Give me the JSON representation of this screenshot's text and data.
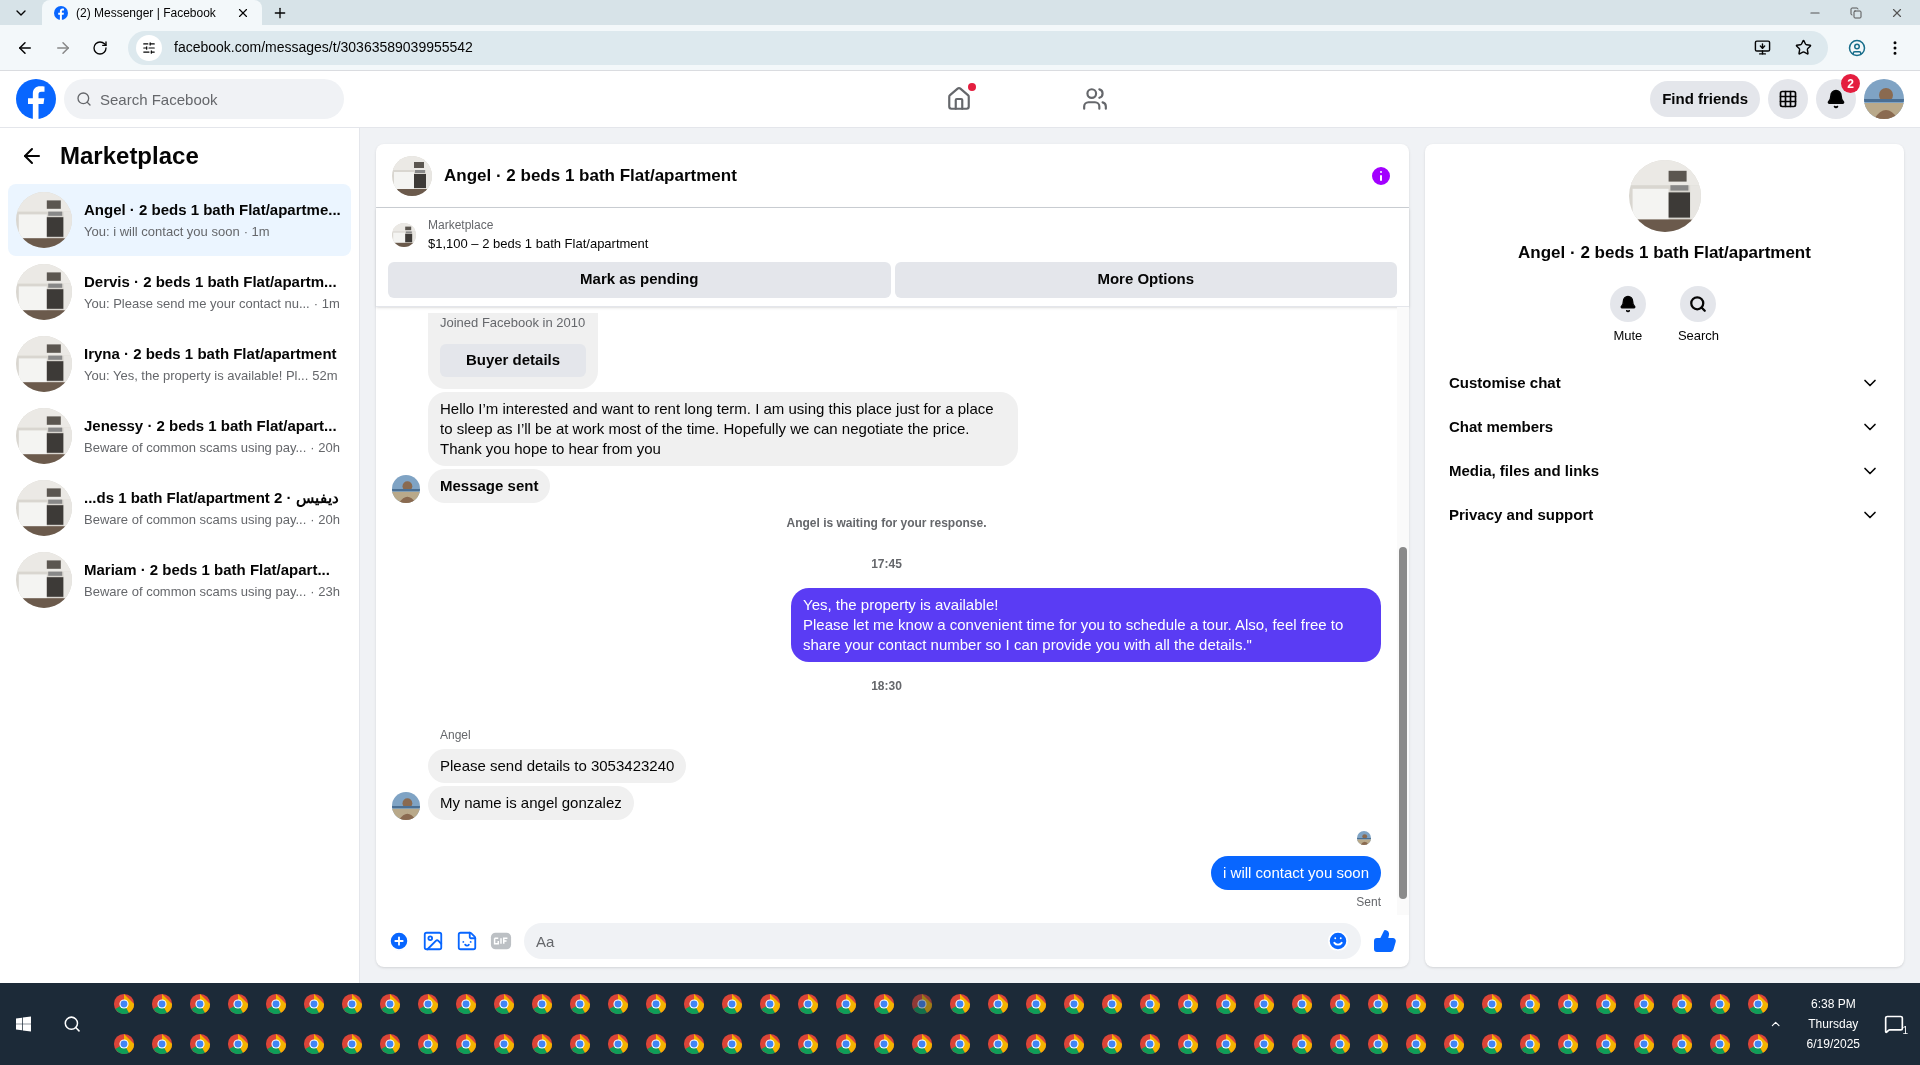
{
  "browser": {
    "tab_title": "(2) Messenger | Facebook",
    "url": "facebook.com/messages/t/30363589039955542"
  },
  "topbar": {
    "search": {
      "placeholder": "Search Facebook"
    },
    "find_friends": "Find friends",
    "notification_count": "2"
  },
  "sidebar": {
    "title": "Marketplace",
    "conversations": [
      {
        "title": "Angel · 2 beds 1 bath Flat/apartme...",
        "preview": "You: i will contact you soon",
        "time": "· 1m",
        "selected": true
      },
      {
        "title": "Dervis · 2 beds 1 bath Flat/apartm...",
        "preview": "You: Please send me your contact nu...",
        "time": "· 1m",
        "selected": false
      },
      {
        "title": "Iryna · 2 beds 1 bath Flat/apartment",
        "preview": "You: Yes, the property is available! Pl...",
        "time": "52m",
        "selected": false
      },
      {
        "title": "Jenessy · 2 beds 1 bath Flat/apart...",
        "preview": "Beware of common scams using pay...",
        "time": "· 20h",
        "selected": false
      },
      {
        "title": "...ds 1 bath Flat/apartment 2 · ديفيس",
        "preview": "Beware of common scams using pay...",
        "time": "· 20h",
        "selected": false
      },
      {
        "title": "Mariam · 2 beds 1 bath Flat/apart...",
        "preview": "Beware of common scams using pay...",
        "time": "· 23h",
        "selected": false
      }
    ]
  },
  "chat": {
    "title": "Angel · 2 beds 1 bath Flat/apartment",
    "listing": {
      "label": "Marketplace",
      "name": "$1,100 – 2 beds 1 bath Flat/apartment"
    },
    "actions": [
      "Mark as pending",
      "More Options"
    ],
    "messages": [
      {
        "kind": "profile_card",
        "text": "Joined Facebook in 2010",
        "button": "Buyer details"
      },
      {
        "kind": "incoming",
        "text": "Hello I’m interested and want to rent long term. I am using this place just for a place to sleep as I’ll be at work most of the time. Hopefully we can negotiate the price. Thank you hope to hear from you",
        "avatar": false,
        "bold": false
      },
      {
        "kind": "incoming",
        "text": "Message sent",
        "avatar": true,
        "bold": true
      },
      {
        "kind": "notice",
        "text": "Angel is waiting for your response."
      },
      {
        "kind": "time",
        "text": "17:45"
      },
      {
        "kind": "outgoing",
        "text": "Yes, the property is available!\nPlease let me know a convenient time for you to schedule a tour. Also, feel free to share your contact number so I can provide you with all the details.\"",
        "color": "#5a3cf4"
      },
      {
        "kind": "time",
        "text": "18:30"
      },
      {
        "kind": "sender",
        "text": "Angel"
      },
      {
        "kind": "incoming",
        "text": "Please send details to 3053423240",
        "avatar": false,
        "bold": false
      },
      {
        "kind": "incoming",
        "text": "My name is angel gonzalez",
        "avatar": true,
        "bold": false
      },
      {
        "kind": "seen"
      },
      {
        "kind": "outgoing",
        "text": "i will contact you soon",
        "color": "#0866ff"
      },
      {
        "kind": "status",
        "text": "Sent"
      }
    ],
    "composer": {
      "placeholder": "Aa"
    }
  },
  "info_panel": {
    "title": "Angel · 2 beds 1 bath Flat/apartment",
    "actions": [
      {
        "kind": "mute",
        "label": "Mute"
      },
      {
        "kind": "search",
        "label": "Search"
      }
    ],
    "sections": [
      {
        "label": "Customise chat",
        "expanded": false
      },
      {
        "label": "Chat members",
        "expanded": false
      },
      {
        "label": "Media, files and links",
        "expanded": false
      },
      {
        "label": "Privacy and support",
        "expanded": false
      }
    ]
  },
  "taskbar": {
    "time": "6:38 PM",
    "day": "Thursday",
    "date": "6/19/2025",
    "notification_count": "1"
  }
}
